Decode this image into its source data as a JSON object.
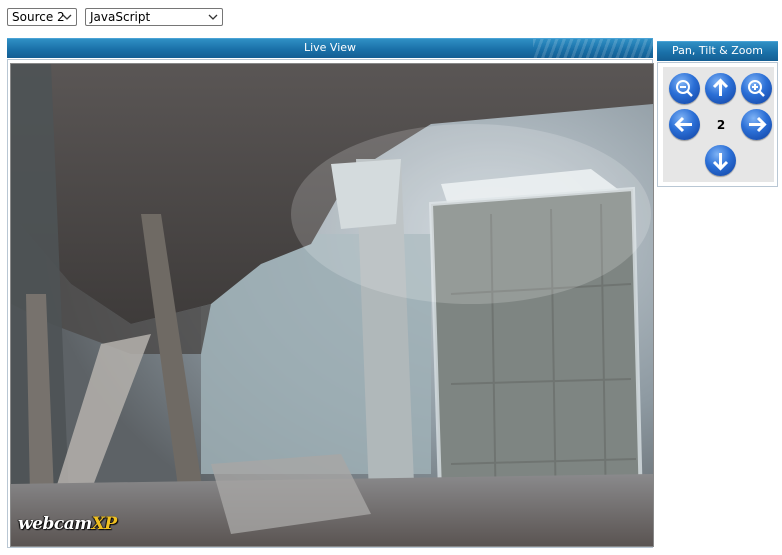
{
  "source_select": {
    "value": "Source 2"
  },
  "mode_select": {
    "value": "JavaScript"
  },
  "live_view": {
    "title": "Live View",
    "watermark_main": "webcam",
    "watermark_accent": "XP"
  },
  "ptz": {
    "title": "Pan, Tilt & Zoom",
    "zoom_level": "2",
    "buttons": [
      "zoom-out-icon",
      "arrow-up-icon",
      "zoom-in-icon",
      "arrow-left-icon",
      "arrow-right-icon",
      "arrow-down-icon"
    ]
  },
  "colors": {
    "header_blue": "#1a70a8",
    "button_blue": "#2b6fd6",
    "panel_bg": "#e6e6e6"
  }
}
